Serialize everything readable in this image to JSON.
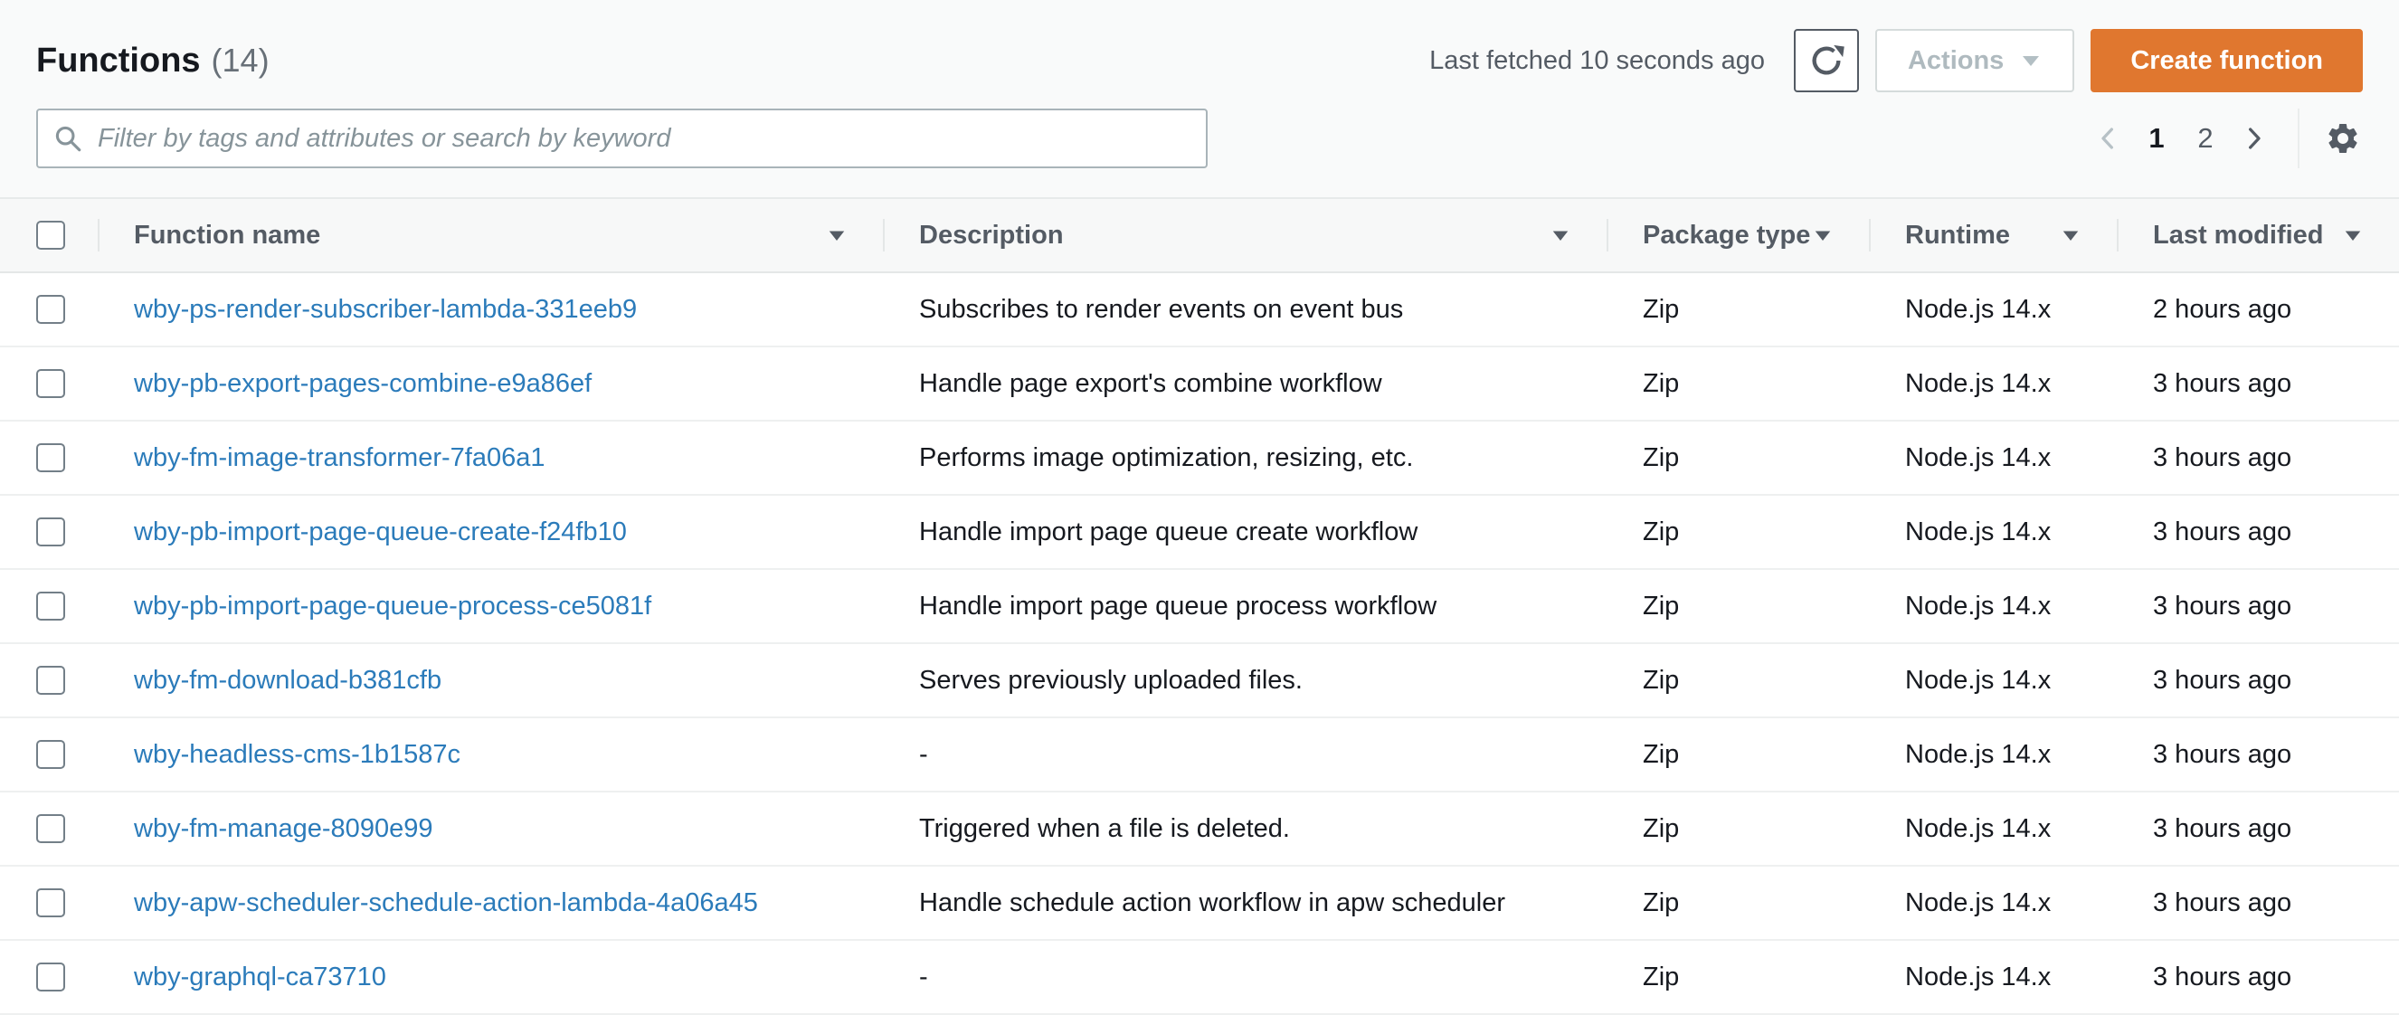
{
  "page": {
    "title": "Functions",
    "count": "(14)",
    "last_fetched": "Last fetched 10 seconds ago",
    "actions_label": "Actions",
    "create_function_label": "Create function"
  },
  "filter": {
    "placeholder": "Filter by tags and attributes or search by keyword"
  },
  "pagination": {
    "pages": [
      "1",
      "2"
    ],
    "current_page": "1"
  },
  "icons": {
    "search-icon": "magnifier",
    "refresh-icon": "circular-arrow",
    "caret-down-icon": "filled triangle down",
    "sort-icon": "filled triangle down",
    "chevron-left-icon": "angle left",
    "chevron-right-icon": "angle right",
    "gear-icon": "settings gear"
  },
  "colors": {
    "accent_orange": "#e0772f",
    "link_blue": "#2b7bba",
    "header_text": "#545b64",
    "body_text": "#16191f",
    "disabled_text": "#afbabf",
    "border": "#eaeded",
    "page_bg": "#f9fafa"
  },
  "table": {
    "columns": [
      "Function name",
      "Description",
      "Package type",
      "Runtime",
      "Last modified"
    ],
    "rows": [
      {
        "name": "wby-ps-render-subscriber-lambda-331eeb9",
        "description": "Subscribes to render events on event bus",
        "package_type": "Zip",
        "runtime": "Node.js 14.x",
        "last_modified": "2 hours ago"
      },
      {
        "name": "wby-pb-export-pages-combine-e9a86ef",
        "description": "Handle page export's combine workflow",
        "package_type": "Zip",
        "runtime": "Node.js 14.x",
        "last_modified": "3 hours ago"
      },
      {
        "name": "wby-fm-image-transformer-7fa06a1",
        "description": "Performs image optimization, resizing, etc.",
        "package_type": "Zip",
        "runtime": "Node.js 14.x",
        "last_modified": "3 hours ago"
      },
      {
        "name": "wby-pb-import-page-queue-create-f24fb10",
        "description": "Handle import page queue create workflow",
        "package_type": "Zip",
        "runtime": "Node.js 14.x",
        "last_modified": "3 hours ago"
      },
      {
        "name": "wby-pb-import-page-queue-process-ce5081f",
        "description": "Handle import page queue process workflow",
        "package_type": "Zip",
        "runtime": "Node.js 14.x",
        "last_modified": "3 hours ago"
      },
      {
        "name": "wby-fm-download-b381cfb",
        "description": "Serves previously uploaded files.",
        "package_type": "Zip",
        "runtime": "Node.js 14.x",
        "last_modified": "3 hours ago"
      },
      {
        "name": "wby-headless-cms-1b1587c",
        "description": "-",
        "package_type": "Zip",
        "runtime": "Node.js 14.x",
        "last_modified": "3 hours ago"
      },
      {
        "name": "wby-fm-manage-8090e99",
        "description": "Triggered when a file is deleted.",
        "package_type": "Zip",
        "runtime": "Node.js 14.x",
        "last_modified": "3 hours ago"
      },
      {
        "name": "wby-apw-scheduler-schedule-action-lambda-4a06a45",
        "description": "Handle schedule action workflow in apw scheduler",
        "package_type": "Zip",
        "runtime": "Node.js 14.x",
        "last_modified": "3 hours ago"
      },
      {
        "name": "wby-graphql-ca73710",
        "description": "-",
        "package_type": "Zip",
        "runtime": "Node.js 14.x",
        "last_modified": "3 hours ago"
      }
    ]
  }
}
